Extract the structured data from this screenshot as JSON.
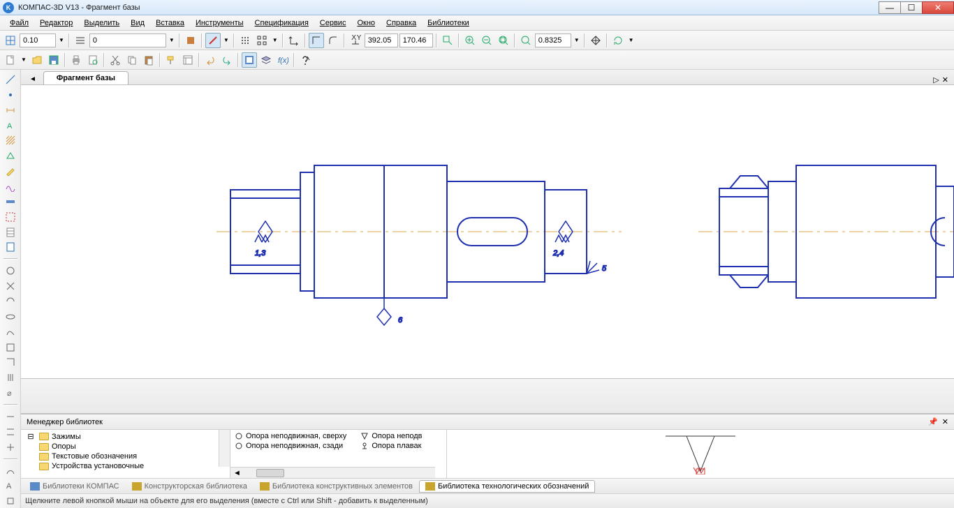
{
  "window": {
    "title": "КОМПАС-3D V13 - Фрагмент базы"
  },
  "menu": [
    "Файл",
    "Редактор",
    "Выделить",
    "Вид",
    "Вставка",
    "Инструменты",
    "Спецификация",
    "Сервис",
    "Окно",
    "Справка",
    "Библиотеки"
  ],
  "toolbar1": {
    "step": "0.10",
    "style_num": "0",
    "coord_x": "392.05",
    "coord_y": "170.46",
    "zoom": "0.8325"
  },
  "doc": {
    "tab": "Фрагмент базы"
  },
  "drawing": {
    "labels": {
      "l13": "1,3",
      "l24": "2,4",
      "l5": "5",
      "l6": "6"
    }
  },
  "libmgr": {
    "title": "Менеджер библиотек",
    "tree": [
      "Зажимы",
      "Опоры",
      "Текстовые обозначения",
      "Устройства установочные"
    ],
    "list_left": [
      {
        "icon": "circle",
        "label": "Опора неподвижная, сверху"
      },
      {
        "icon": "circle",
        "label": "Опора неподвижная, сзади"
      }
    ],
    "list_right": [
      {
        "icon": "tri",
        "label": "Опора неподв"
      },
      {
        "icon": "dot",
        "label": "Опора плавак"
      }
    ]
  },
  "lib_tabs": [
    "Библиотеки КОМПАС",
    "Конструкторская библиотека",
    "Библиотека конструктивных элементов",
    "Библиотека технологических обозначений"
  ],
  "status": "Щелкните левой кнопкой мыши на объекте для его выделения (вместе с Ctrl или Shift - добавить к выделенным)"
}
